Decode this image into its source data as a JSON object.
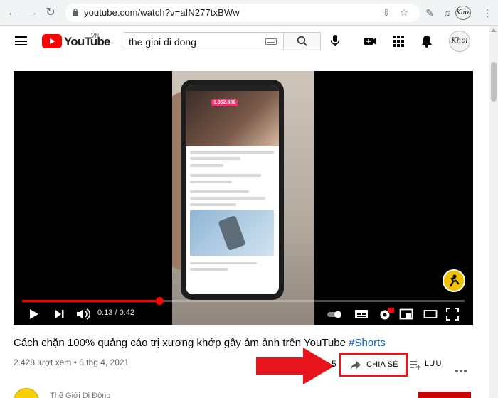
{
  "browser": {
    "url": "youtube.com/watch?v=aIN277txBWw",
    "profile_label": "Khoi"
  },
  "header": {
    "logo_text": "YouTube",
    "country_code": "VN",
    "search_value": "the gioi di dong",
    "avatar_label": "Khoi"
  },
  "player": {
    "time": "0:13 / 0:42",
    "progress": 0.31,
    "phone_price_text": "1.062.800"
  },
  "video": {
    "title_text": "Cách chặn 100% quảng cáo trị xương khớp gây ám ảnh trên YouTube ",
    "title_hashtag": "#Shorts",
    "views": "2.428 lượt xem",
    "separator": "•",
    "date": "6 thg 4, 2021",
    "like_count": "5",
    "share_label": "CHIA SẺ",
    "save_label": "LƯU"
  },
  "channel": {
    "name": "Thế Giới Di Động"
  },
  "colors": {
    "brand_red": "#ff0000",
    "highlight_red": "#e8141b",
    "link_blue": "#065fd4"
  }
}
